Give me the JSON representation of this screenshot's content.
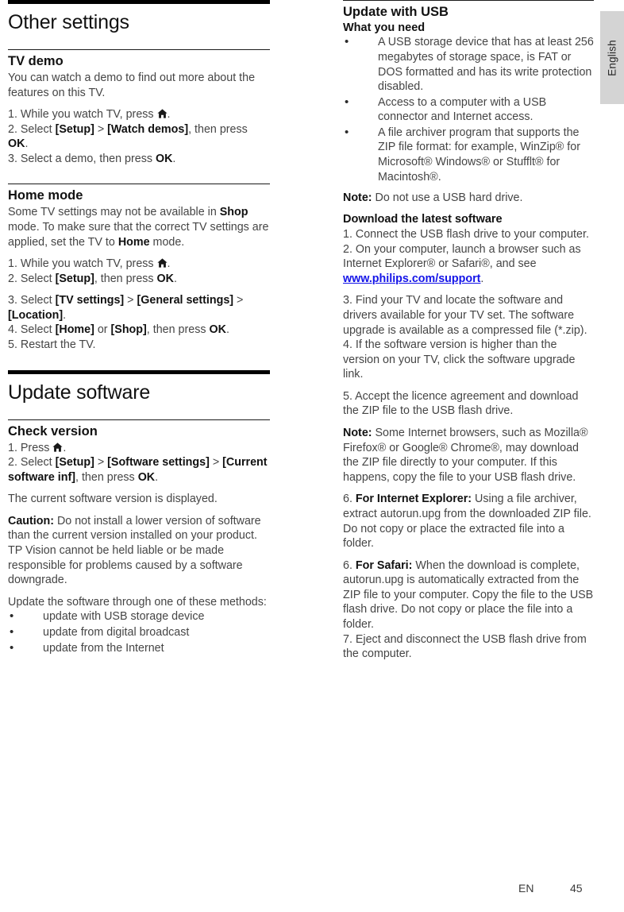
{
  "language_tab": "English",
  "footer": {
    "lang_code": "EN",
    "page_number": "45"
  },
  "left_column": {
    "chapter_title": "Other settings",
    "sections": [
      {
        "heading": "TV demo",
        "intro": "You can watch a demo to find out more about the features on this TV.",
        "step1_a": "1. While you watch TV, press ",
        "step1_b": ".",
        "step2_a": "2. Select ",
        "step2_setup": "[Setup]",
        "step2_gt": " > ",
        "step2_watch": "[Watch demos]",
        "step2_c": ", then press ",
        "step2_ok": "OK",
        "step2_d": ".",
        "step3_a": "3. Select a demo, then press ",
        "step3_ok": "OK",
        "step3_b": "."
      },
      {
        "heading": "Home mode",
        "para_a": "Some TV settings may not be available in ",
        "para_shop": "Shop",
        "para_b": " mode. To make sure that the correct TV settings are applied, set the TV to ",
        "para_home": "Home",
        "para_c": " mode.",
        "step1_a": "1. While you watch TV, press ",
        "step1_b": ".",
        "step2_a": "2. Select ",
        "step2_setup": "[Setup]",
        "step2_b": ", then press ",
        "step2_ok": "OK",
        "step2_c": ".",
        "step3_a": "3. Select ",
        "step3_tvsettings": "[TV settings]",
        "step3_gt1": " > ",
        "step3_general": "[General settings]",
        "step3_gt2": " > ",
        "step3_location": "[Location]",
        "step3_end": ".",
        "step4_a": "4. Select ",
        "step4_home": "[Home]",
        "step4_or": " or ",
        "step4_shop": "[Shop]",
        "step4_b": ", then press ",
        "step4_ok": "OK",
        "step4_c": ".",
        "step5": "5. Restart the TV."
      }
    ],
    "chapter_title_2": "Update software",
    "sections_2": [
      {
        "heading": "Check version",
        "step1_a": "1. Press ",
        "step1_b": ".",
        "step2_a": "2. Select ",
        "step2_setup": "[Setup]",
        "step2_gt1": " > ",
        "step2_software": "[Software settings]",
        "step2_gt2": " > ",
        "step2_current": "[Current software inf]",
        "step2_b": ", then press ",
        "step2_ok": "OK",
        "step2_c": ".",
        "displayed": "The current software version is displayed.",
        "caution_label": "Caution:",
        "caution_text": " Do not install a lower version of software than the current version installed on your product. TP Vision cannot be held liable or be made responsible for problems caused by a software downgrade.",
        "methods_intro": "Update the software through one of these methods:",
        "methods": [
          "update with USB storage device",
          "update from digital broadcast",
          "update from the Internet"
        ]
      }
    ]
  },
  "right_column": {
    "section_heading": "Update with USB",
    "sub_heading_1": "What you need",
    "requirements": [
      "A USB storage device that has at least 256 megabytes of storage space, is FAT or DOS formatted and has its write protection disabled.",
      "Access to a computer with a USB connector and Internet access.",
      "A file archiver program that supports the ZIP file format: for example, WinZip® for Microsoft® Windows® or Stufflt® for Macintosh®."
    ],
    "note1_label": "Note:",
    "note1_text": " Do not use a USB hard drive.",
    "sub_heading_2": "Download the latest software",
    "step1": "1. Connect the USB flash drive to your computer.",
    "step2_a": "2. On your computer, launch a browser such as Internet Explorer® or Safari®, and see ",
    "step2_link": "www.philips.com/support",
    "step2_b": ".",
    "step3": "3. Find your TV and locate the software and drivers available for your TV set. The software upgrade is available as a compressed file (*.zip).",
    "step4": "4. If the software version is higher than the version on your TV, click the software upgrade link.",
    "step5": "5. Accept the licence agreement and download the ZIP file to the USB flash drive.",
    "note2_label": "Note:",
    "note2_text": " Some Internet browsers, such as Mozilla® Firefox® or Google® Chrome®, may download the ZIP file directly to your computer. If this happens, copy the file to your USB flash drive.",
    "step6_ie_num": "6. ",
    "step6_ie_label": "For Internet Explorer:",
    "step6_ie_text": " Using a file archiver, extract autorun.upg from the downloaded ZIP file. Do not copy or place the extracted file into a folder.",
    "step6_safari_num": "6. ",
    "step6_safari_label": "For Safari:",
    "step6_safari_text": " When the download is complete, autorun.upg is automatically extracted from the ZIP file to your computer. Copy the file to the USB flash drive. Do not copy or place the file into a folder.",
    "step7": "7. Eject and disconnect the USB flash drive from the computer."
  },
  "icons": {
    "home": "home-icon"
  },
  "colors": {
    "link": "#1414e8",
    "tab_bg": "#d4d4d4",
    "text": "#454545",
    "heading": "#111111"
  }
}
